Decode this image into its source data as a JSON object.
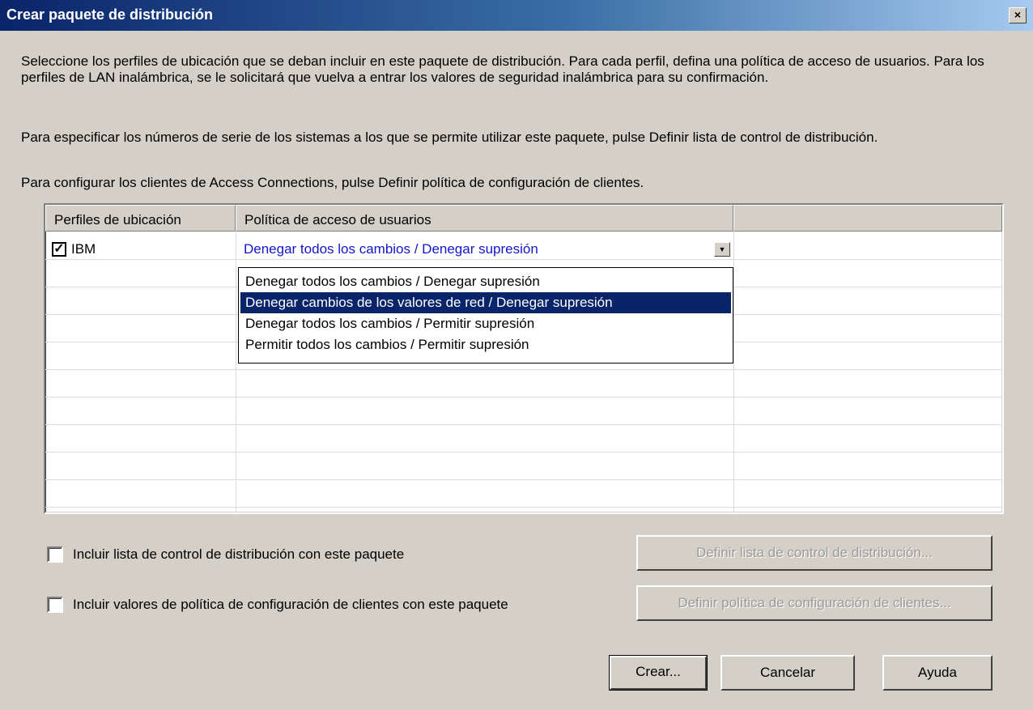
{
  "window": {
    "title": "Crear paquete de distribución",
    "close_glyph": "×"
  },
  "instructions": {
    "p1": "Seleccione los perfiles de ubicación que se deban incluir en este paquete de distribución. Para cada perfil, defina una política de acceso de usuarios. Para los perfiles de LAN inalámbrica, se le solicitará que vuelva a entrar los valores de seguridad inalámbrica para su confirmación.",
    "p2": "Para especificar los números de serie de los sistemas a los que se permite utilizar este paquete, pulse Definir lista de control de distribución.",
    "p3": "Para configurar los clientes de Access Connections, pulse Definir política de configuración de clientes."
  },
  "grid": {
    "columns": [
      "Perfiles de ubicación",
      "Política de acceso de usuarios",
      ""
    ],
    "rows": [
      {
        "profile": "IBM",
        "checked": true,
        "policy": "Denegar todos los cambios / Denegar supresión"
      }
    ]
  },
  "dropdown": {
    "options": [
      "Denegar todos los cambios / Denegar supresión",
      "Denegar cambios de los valores de red / Denegar supresión",
      "Denegar todos los cambios / Permitir supresión",
      "Permitir todos los cambios / Permitir supresión"
    ],
    "highlighted_index": 1
  },
  "options": {
    "include_acl": {
      "label": "Incluir lista de control de distribución con este paquete",
      "checked": false
    },
    "include_policy": {
      "label": "Incluir valores de política de configuración de clientes con este paquete",
      "checked": false
    }
  },
  "buttons": {
    "define_acl": "Definir lista de control de distribución...",
    "define_policy": "Definir política de configuración de clientes...",
    "create": "Crear...",
    "cancel": "Cancelar",
    "help": "Ayuda"
  },
  "colors": {
    "title_gradient_start": "#0a246a",
    "selection": "#0a246a",
    "combo_text": "#1515c8"
  }
}
